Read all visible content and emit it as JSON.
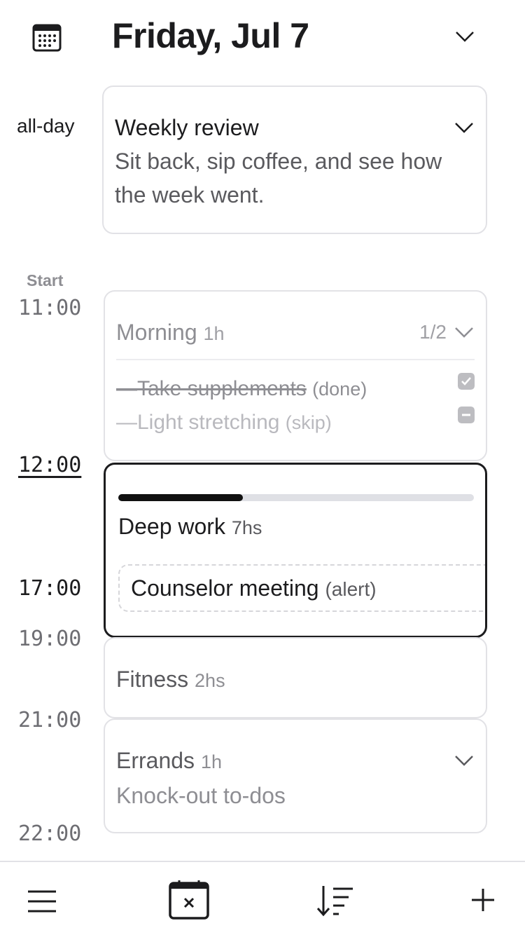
{
  "header": {
    "title": "Friday, Jul 7",
    "calendar_icon": "calendar-grid-icon",
    "chevron_icon": "chevron-down-icon"
  },
  "allday": {
    "label": "all-day",
    "event": {
      "title": "Weekly review",
      "description_line1": "Sit back, sip coffee, and see how",
      "description_line2": "the week went."
    }
  },
  "timeline": {
    "start_label": "Start",
    "times": [
      "11:00",
      "12:00",
      "17:00",
      "19:00",
      "21:00",
      "22:00"
    ]
  },
  "morning": {
    "title": "Morning",
    "duration": "1h",
    "count": "1/2",
    "tasks": [
      {
        "text": "—Take supplements",
        "note": "(done)",
        "state": "done"
      },
      {
        "text": "—Light stretching",
        "note": "(skip)",
        "state": "skip"
      }
    ]
  },
  "deep_work": {
    "title": "Deep work",
    "duration": "7hs",
    "progress": 0.35,
    "sub_event": {
      "title": "Counselor meeting",
      "note": "(alert)"
    }
  },
  "fitness": {
    "title": "Fitness",
    "duration": "2hs"
  },
  "errands": {
    "title": "Errands",
    "duration": "1h",
    "description": "Knock-out to-dos"
  },
  "bottom_bar": {
    "icons": [
      "menu-icon",
      "calendar-x-icon",
      "sort-icon",
      "plus-icon"
    ]
  },
  "colors": {
    "accent": "#1c1c1e",
    "progress_fill": "#111111",
    "progress_track": "#dfe0e5",
    "border": "#e2e2e6"
  }
}
